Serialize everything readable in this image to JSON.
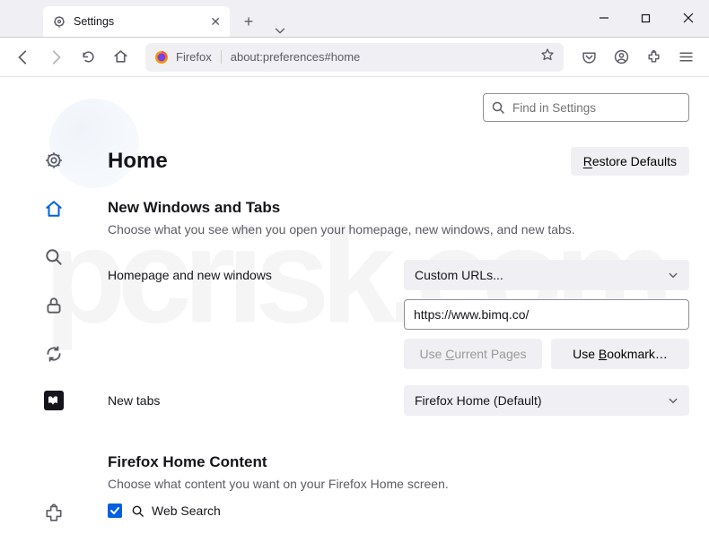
{
  "tab": {
    "title": "Settings"
  },
  "urlbar": {
    "label": "Firefox",
    "path": "about:preferences#home"
  },
  "search": {
    "placeholder": "Find in Settings"
  },
  "page": {
    "title": "Home",
    "restore": "Restore Defaults",
    "section1_title": "New Windows and Tabs",
    "section1_sub": "Choose what you see when you open your homepage, new windows, and new tabs.",
    "homepage_label": "Homepage and new windows",
    "homepage_select": "Custom URLs...",
    "homepage_url": "https://www.bimq.co/",
    "use_current": "Use Current Pages",
    "use_bookmark": "Use Bookmark…",
    "newtabs_label": "New tabs",
    "newtabs_select": "Firefox Home (Default)",
    "section2_title": "Firefox Home Content",
    "section2_sub": "Choose what content you want on your Firefox Home screen.",
    "websearch": "Web Search"
  }
}
